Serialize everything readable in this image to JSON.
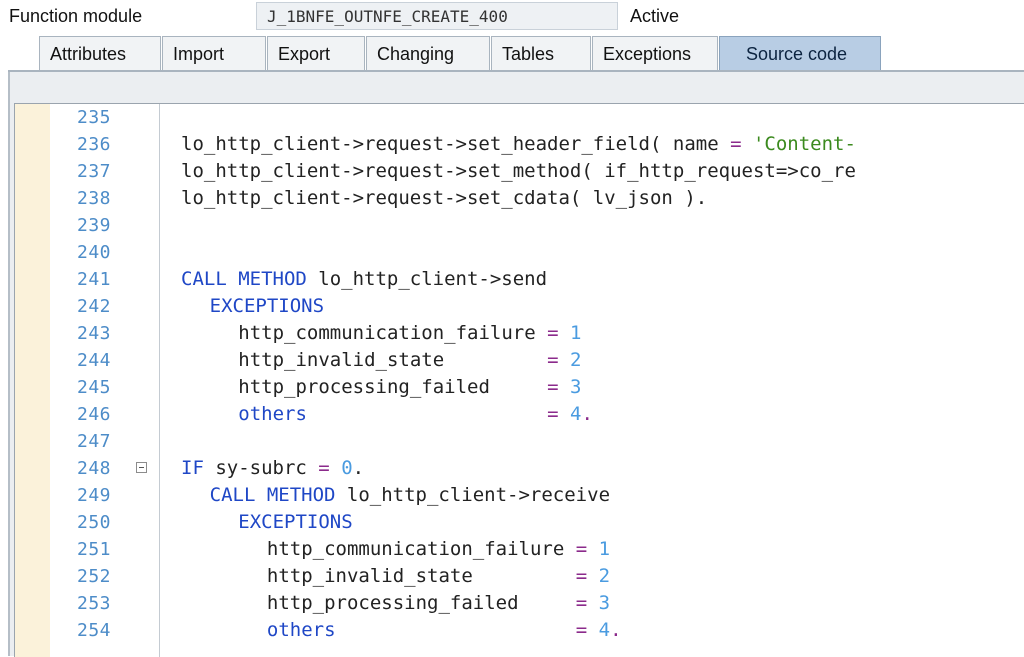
{
  "header": {
    "function_module_label": "Function module",
    "function_module_name": "J_1BNFE_OUTNFE_CREATE_400",
    "status": "Active"
  },
  "tabs": [
    {
      "label": "Attributes",
      "active": false
    },
    {
      "label": "Import",
      "active": false
    },
    {
      "label": "Export",
      "active": false
    },
    {
      "label": "Changing",
      "active": false
    },
    {
      "label": "Tables",
      "active": false
    },
    {
      "label": "Exceptions",
      "active": false
    },
    {
      "label": "Source code",
      "active": true
    }
  ],
  "colors": {
    "keyword": "#1f47c6",
    "number": "#4a9be0",
    "operator": "#8b2a8b",
    "string": "#3b8a1e",
    "line_number": "#4d8cc8",
    "active_tab": "#b8cde4"
  },
  "editor": {
    "lines": [
      {
        "num": "235",
        "indent": 0,
        "fold": false,
        "parts": []
      },
      {
        "num": "236",
        "indent": 0,
        "fold": false,
        "parts": [
          {
            "t": "lo_http_client->request->set_header_field( name ",
            "c": "id"
          },
          {
            "t": "=",
            "c": "op"
          },
          {
            "t": " ",
            "c": "id"
          },
          {
            "t": "'Content-",
            "c": "str"
          }
        ]
      },
      {
        "num": "237",
        "indent": 0,
        "fold": false,
        "parts": [
          {
            "t": "lo_http_client->request->set_method( if_http_request=>co_re",
            "c": "id"
          }
        ]
      },
      {
        "num": "238",
        "indent": 0,
        "fold": false,
        "parts": [
          {
            "t": "lo_http_client->request->set_cdata( lv_json ).",
            "c": "id"
          }
        ]
      },
      {
        "num": "239",
        "indent": 0,
        "fold": false,
        "parts": []
      },
      {
        "num": "240",
        "indent": 0,
        "fold": false,
        "parts": []
      },
      {
        "num": "241",
        "indent": 0,
        "fold": false,
        "parts": [
          {
            "t": "CALL METHOD",
            "c": "kw"
          },
          {
            "t": " lo_http_client->send",
            "c": "id"
          }
        ]
      },
      {
        "num": "242",
        "indent": 1,
        "fold": false,
        "parts": [
          {
            "t": "EXCEPTIONS",
            "c": "kw"
          }
        ]
      },
      {
        "num": "243",
        "indent": 2,
        "fold": false,
        "parts": [
          {
            "t": "http_communication_failure ",
            "c": "id"
          },
          {
            "t": "=",
            "c": "op"
          },
          {
            "t": " ",
            "c": "id"
          },
          {
            "t": "1",
            "c": "num"
          }
        ]
      },
      {
        "num": "244",
        "indent": 2,
        "fold": false,
        "parts": [
          {
            "t": "http_invalid_state         ",
            "c": "id"
          },
          {
            "t": "=",
            "c": "op"
          },
          {
            "t": " ",
            "c": "id"
          },
          {
            "t": "2",
            "c": "num"
          }
        ]
      },
      {
        "num": "245",
        "indent": 2,
        "fold": false,
        "parts": [
          {
            "t": "http_processing_failed     ",
            "c": "id"
          },
          {
            "t": "=",
            "c": "op"
          },
          {
            "t": " ",
            "c": "id"
          },
          {
            "t": "3",
            "c": "num"
          }
        ]
      },
      {
        "num": "246",
        "indent": 2,
        "fold": false,
        "parts": [
          {
            "t": "others",
            "c": "kw"
          },
          {
            "t": "                     ",
            "c": "id"
          },
          {
            "t": "=",
            "c": "op"
          },
          {
            "t": " ",
            "c": "id"
          },
          {
            "t": "4",
            "c": "num"
          },
          {
            "t": ".",
            "c": "op"
          }
        ]
      },
      {
        "num": "247",
        "indent": 0,
        "fold": false,
        "parts": []
      },
      {
        "num": "248",
        "indent": 0,
        "fold": true,
        "parts": [
          {
            "t": "IF",
            "c": "kw"
          },
          {
            "t": " sy-subrc ",
            "c": "id"
          },
          {
            "t": "=",
            "c": "op"
          },
          {
            "t": " ",
            "c": "id"
          },
          {
            "t": "0",
            "c": "num"
          },
          {
            "t": ".",
            "c": "id"
          }
        ]
      },
      {
        "num": "249",
        "indent": 1,
        "fold": false,
        "parts": [
          {
            "t": "CALL METHOD",
            "c": "kw"
          },
          {
            "t": " lo_http_client->receive",
            "c": "id"
          }
        ]
      },
      {
        "num": "250",
        "indent": 2,
        "fold": false,
        "parts": [
          {
            "t": "EXCEPTIONS",
            "c": "kw"
          }
        ]
      },
      {
        "num": "251",
        "indent": 3,
        "fold": false,
        "parts": [
          {
            "t": "http_communication_failure ",
            "c": "id"
          },
          {
            "t": "=",
            "c": "op"
          },
          {
            "t": " ",
            "c": "id"
          },
          {
            "t": "1",
            "c": "num"
          }
        ]
      },
      {
        "num": "252",
        "indent": 3,
        "fold": false,
        "parts": [
          {
            "t": "http_invalid_state         ",
            "c": "id"
          },
          {
            "t": "=",
            "c": "op"
          },
          {
            "t": " ",
            "c": "id"
          },
          {
            "t": "2",
            "c": "num"
          }
        ]
      },
      {
        "num": "253",
        "indent": 3,
        "fold": false,
        "parts": [
          {
            "t": "http_processing_failed     ",
            "c": "id"
          },
          {
            "t": "=",
            "c": "op"
          },
          {
            "t": " ",
            "c": "id"
          },
          {
            "t": "3",
            "c": "num"
          }
        ]
      },
      {
        "num": "254",
        "indent": 3,
        "fold": false,
        "parts": [
          {
            "t": "others",
            "c": "kw"
          },
          {
            "t": "                     ",
            "c": "id"
          },
          {
            "t": "=",
            "c": "op"
          },
          {
            "t": " ",
            "c": "id"
          },
          {
            "t": "4",
            "c": "num"
          },
          {
            "t": ".",
            "c": "op"
          }
        ]
      }
    ]
  }
}
